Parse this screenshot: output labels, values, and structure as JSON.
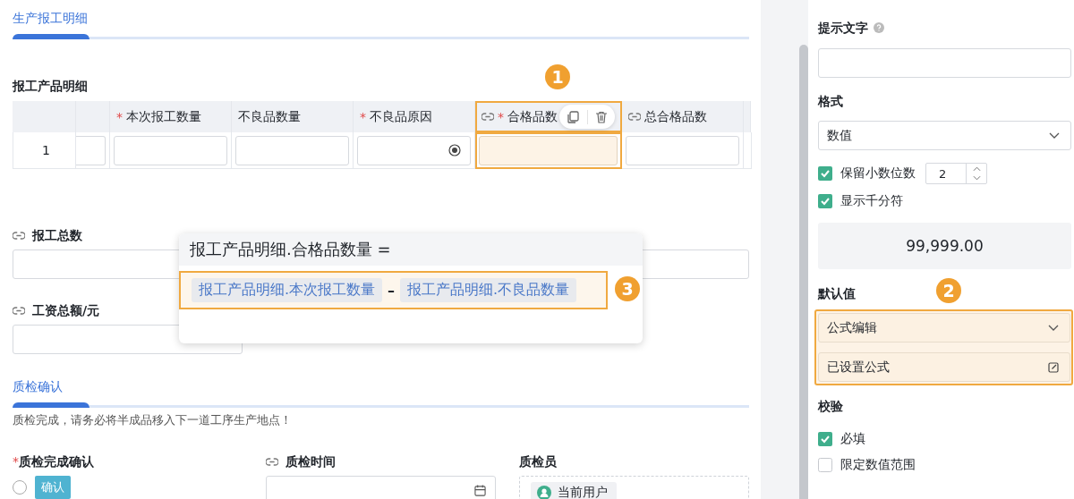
{
  "section_1": {
    "title": "生产报工明细"
  },
  "subtable": {
    "title": "报工产品明细",
    "columns": [
      {
        "kind": "index",
        "selected": false
      },
      {
        "kind": "partial",
        "selected": false
      },
      {
        "kind": "input",
        "mark": "*",
        "label": "本次报工数量",
        "linked": false,
        "selected": false
      },
      {
        "kind": "input",
        "label": "不良品数量",
        "linked": false,
        "selected": false
      },
      {
        "kind": "picker",
        "mark": "*",
        "label": "不良品原因",
        "linked": false,
        "selected": false
      },
      {
        "kind": "input",
        "mark": "*",
        "label": "合格品数",
        "linked": true,
        "selected": true,
        "callout": "1"
      },
      {
        "kind": "input",
        "label": "总合格品数",
        "linked": true,
        "selected": false
      },
      {
        "kind": "partial",
        "selected": false
      }
    ],
    "rows": [
      {
        "index": "1"
      }
    ]
  },
  "fields": [
    {
      "kind": "input",
      "label": "报工总数",
      "linked": true
    },
    {
      "kind": "input"
    },
    {
      "kind": "input",
      "label": "工资总额/元",
      "linked": true
    }
  ],
  "formula_popup": {
    "target": "报工产品明细.合格品数量 =",
    "callout": "3",
    "tokens": [
      {
        "kind": "field",
        "text": "报工产品明细.本次报工数量"
      },
      {
        "kind": "operator",
        "text": "–"
      },
      {
        "kind": "field",
        "text": "报工产品明细.不良品数量"
      }
    ]
  },
  "section_2": {
    "title": "质检确认",
    "note": "质检完成，请务必将半成品移入下一道工序生产地点！",
    "fields": [
      {
        "kind": "confirm",
        "mark": "*",
        "label": "质检完成确认",
        "linked": false,
        "option": "确认",
        "checked": false
      },
      {
        "kind": "date",
        "label": "质检时间",
        "linked": true
      },
      {
        "kind": "user",
        "label": "质检员",
        "linked": false,
        "value": "当前用户"
      }
    ]
  },
  "properties": {
    "hint": {
      "label": "提示文字"
    },
    "format": {
      "label": "格式",
      "value": "数值",
      "options": [
        {
          "kind": "decimals",
          "label": "保留小数位数",
          "checked": true,
          "value": "2"
        },
        {
          "kind": "plain",
          "label": "显示千分符",
          "checked": true
        }
      ],
      "preview": "99,999.00"
    },
    "default_value": {
      "label": "默认值",
      "callout": "2",
      "mode": "公式编辑",
      "formula_status": "已设置公式"
    },
    "validation": {
      "label": "校验",
      "options": [
        {
          "label": "必填",
          "checked": true
        },
        {
          "label": "限定数值范围",
          "checked": false
        }
      ]
    }
  }
}
